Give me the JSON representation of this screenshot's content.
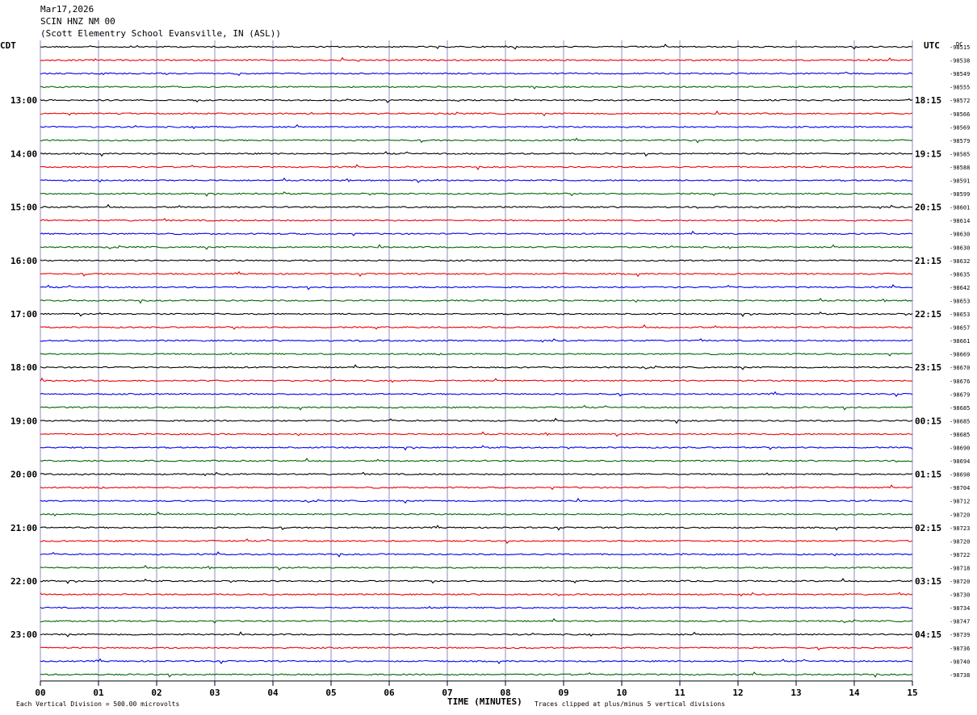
{
  "header": {
    "date": "Mar17,2026",
    "station": "SCIN HNZ NM 00",
    "location": "(Scott Elementry School Evansville, IN (ASL))"
  },
  "left_tz": "CDT",
  "right_tz": "UTC",
  "dc_label": "DC",
  "footer": {
    "scale_note": "Each Vertical Division =  500.00 microvolts",
    "xlabel": "TIME (MINUTES)",
    "clip_note": "Traces clipped at plus/minus 5 vertical divisions"
  },
  "colors": {
    "trace_cycle": [
      "#000000",
      "#ee0000",
      "#0000ee",
      "#006600"
    ],
    "grid": "#8c8cbf"
  },
  "chart_data": {
    "type": "helicorder",
    "xlabel": "TIME (MINUTES)",
    "x_ticks": [
      "00",
      "01",
      "02",
      "03",
      "04",
      "05",
      "06",
      "07",
      "08",
      "09",
      "10",
      "11",
      "12",
      "13",
      "14",
      "15"
    ],
    "xlim": [
      0,
      15
    ],
    "rows_per_hour": 4,
    "left_hour_labels": [
      "13:00",
      "14:00",
      "15:00",
      "16:00",
      "17:00",
      "18:00",
      "19:00",
      "20:00",
      "21:00",
      "22:00",
      "23:00"
    ],
    "right_hour_labels": [
      "18:15",
      "19:15",
      "20:15",
      "21:15",
      "22:15",
      "23:15",
      "00:15",
      "01:15",
      "02:15",
      "03:15",
      "04:15"
    ],
    "first_label_row": 4,
    "dc_offsets": [
      "-98515",
      "-98538",
      "-98549",
      "-98555",
      "-98572",
      "-98566",
      "-98569",
      "-98579",
      "-98585",
      "-98588",
      "-98591",
      "-98599",
      "-98601",
      "-98614",
      "-98630",
      "-98630",
      "-98632",
      "-98635",
      "-98642",
      "-98653",
      "-98653",
      "-98657",
      "-98661",
      "-98669",
      "-98670",
      "-98676",
      "-98679",
      "-98685",
      "-98685",
      "-98685",
      "-98690",
      "-98694",
      "-98698",
      "-98704",
      "-98712",
      "-98720",
      "-98723",
      "-98720",
      "-98722",
      "-98718",
      "-98720",
      "-98730",
      "-98734",
      "-98747",
      "-98739",
      "-98736",
      "-98740",
      "-98738"
    ]
  }
}
